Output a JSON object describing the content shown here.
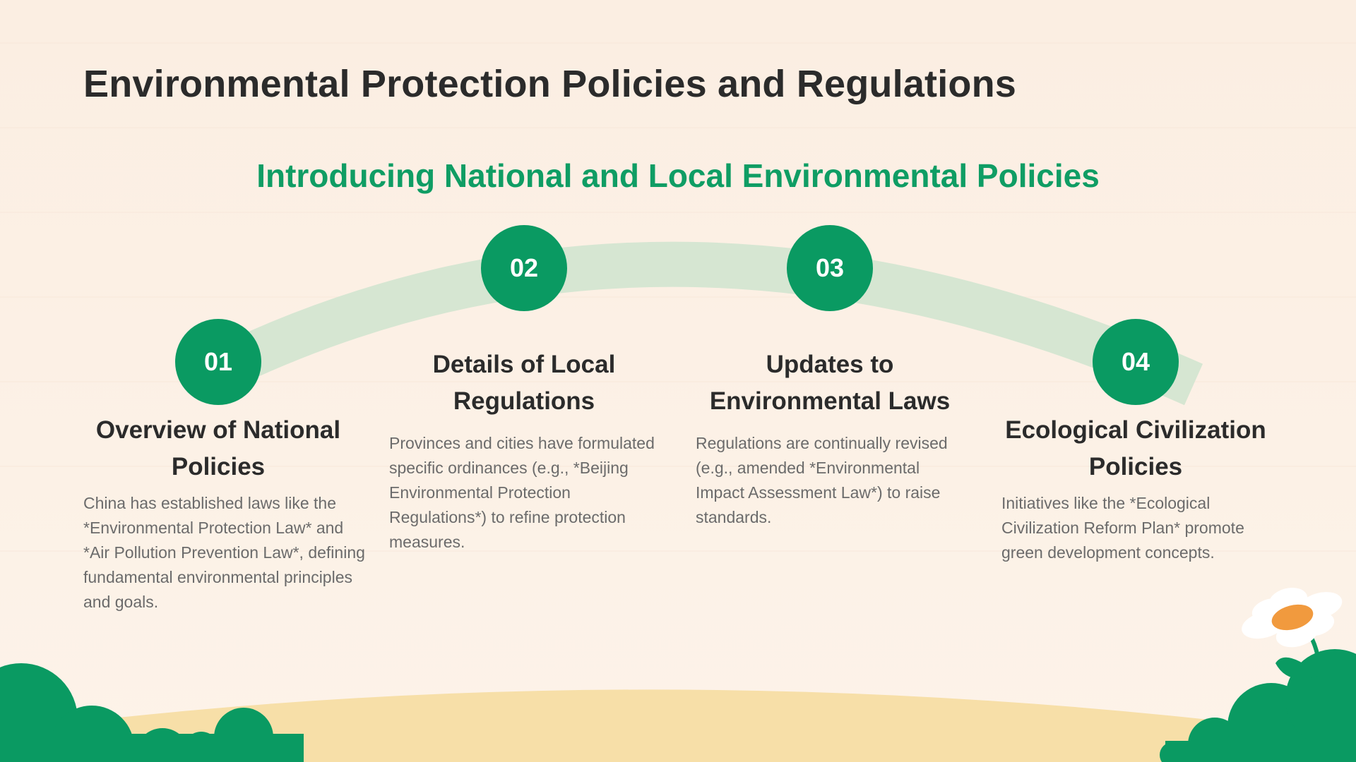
{
  "title": "Environmental Protection Policies and Regulations",
  "subtitle": "Introducing National and Local Environmental Policies",
  "colors": {
    "accent": "#0a9a62",
    "subtitle": "#0f9d64",
    "arc": "#d6e6d2",
    "ground": "#f7dfa8",
    "foliage": "#0a9a62",
    "flower_center": "#f19a3e"
  },
  "steps": [
    {
      "number": "01",
      "heading": "Overview of National Policies",
      "description": "China has established laws like the *Environmental Protection Law* and *Air Pollution Prevention Law*, defining fundamental environmental principles and goals."
    },
    {
      "number": "02",
      "heading": "Details of Local Regulations",
      "description": "Provinces and cities have formulated specific ordinances (e.g., *Beijing Environmental Protection Regulations*) to refine protection measures."
    },
    {
      "number": "03",
      "heading": "Updates to Environmental Laws",
      "description": "Regulations are continually revised (e.g., amended *Environmental Impact Assessment Law*) to raise standards."
    },
    {
      "number": "04",
      "heading": "Ecological Civilization Policies",
      "description": "Initiatives like the *Ecological Civilization Reform Plan* promote green development concepts."
    }
  ],
  "decorations": {
    "left_icon": "bush-icon",
    "right_icon": "daisy-flower-icon"
  }
}
